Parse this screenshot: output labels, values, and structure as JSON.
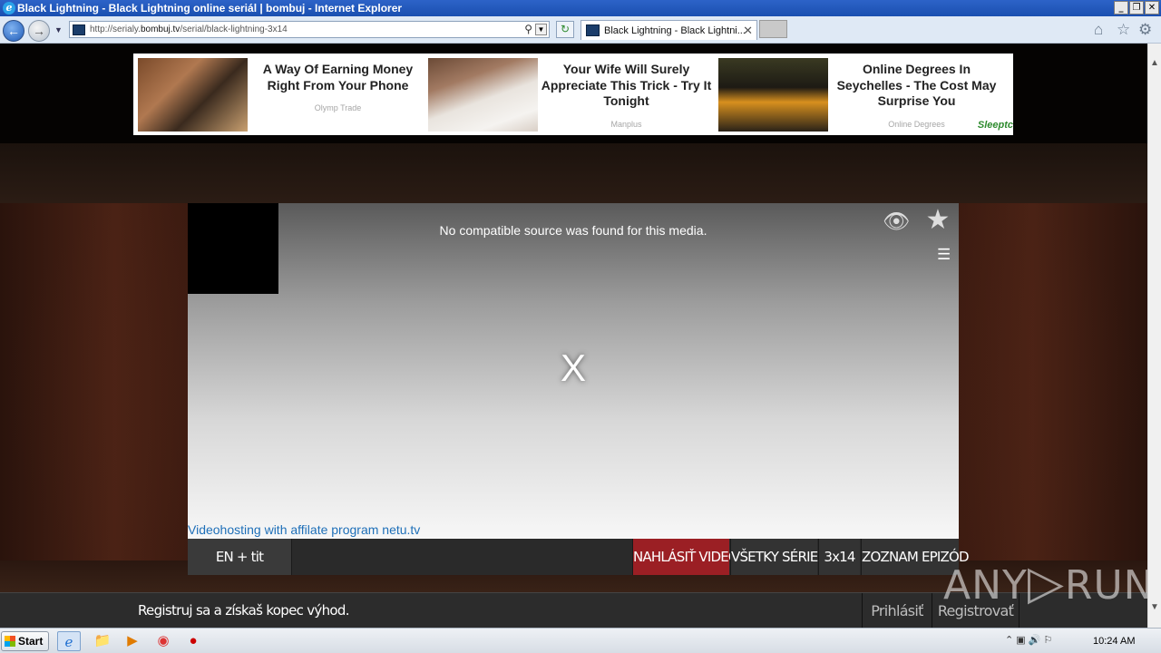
{
  "window": {
    "title": "Black Lightning - Black Lightning online seriál | bombuj - Internet Explorer",
    "controls": {
      "minimize": "_",
      "restore": "❐",
      "close": "✕"
    }
  },
  "browser": {
    "url_prefix": "http://serialy.",
    "url_domain": "bombuj.tv",
    "url_path": "/serial/black-lightning-3x14",
    "tab_title": "Black Lightning - Black Lightni...",
    "tab_close": "✕",
    "icons": {
      "back": "back-arrow-icon",
      "forward": "forward-arrow-icon",
      "home": "home-icon",
      "favorites": "star-icon",
      "tools": "gear-icon"
    }
  },
  "ads": [
    {
      "headline": "A Way Of Earning Money Right From Your Phone",
      "source": "Olymp Trade"
    },
    {
      "headline": "Your Wife Will Surely Appreciate This Trick - Try It Tonight",
      "source": "Manplus"
    },
    {
      "headline": "Online Degrees In Seychelles - The Cost May Surprise You",
      "source": "Online Degrees"
    }
  ],
  "ad_choice": "Sleeptc",
  "player": {
    "error_message": "No compatible source was found for this media.",
    "close_glyph": "X",
    "netu_link": "Videohosting with affilate program netu.tv",
    "menu_glyph": "☰",
    "eye_glyph": "👁",
    "star_glyph": "★"
  },
  "controls": {
    "language": "EN + tit",
    "report": "NAHLÁSIŤ VIDEO",
    "all_series": "VŠETKY SÉRIE",
    "episode": "3x14",
    "episode_list": "ZOZNAM EPIZÓD"
  },
  "register_bar": {
    "text": "Registruj sa a získaš kopec výhod.",
    "login": "Prihlásiť",
    "register": "Registrovať"
  },
  "watermark": {
    "left": "ANY",
    "right": "RUN"
  },
  "taskbar": {
    "start": "Start",
    "clock": "10:24 AM",
    "tray": "⌃ ▣ 🔊 ⚐"
  },
  "colors": {
    "report_accent": "#9b1f24",
    "link": "#1e6fb8",
    "title_bar": "#1a4fb0"
  }
}
